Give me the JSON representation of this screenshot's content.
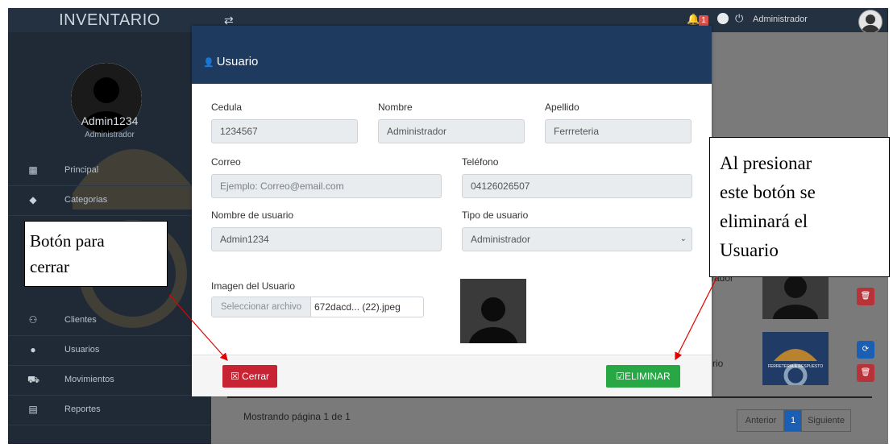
{
  "app": {
    "brand": "INVENTARIO"
  },
  "profile": {
    "name": "Admin1234",
    "role": "Administrador"
  },
  "menu": [
    {
      "label": "Principal",
      "icon": "dashboard-icon"
    },
    {
      "label": "Categorias",
      "icon": "tag-icon"
    },
    {
      "label": "Clientes",
      "icon": "users-icon"
    },
    {
      "label": "Usuarios",
      "icon": "user-icon"
    },
    {
      "label": "Movimientos",
      "icon": "cart-icon"
    },
    {
      "label": "Reportes",
      "icon": "report-icon"
    }
  ],
  "topbar": {
    "notifications": "1",
    "user": "Administrador"
  },
  "background": {
    "pagination_info": "Mostrando página 1 de 1",
    "prev": "Anterior",
    "page": "1",
    "next": "Siguiente",
    "row1_text": "rador",
    "row2_text": "rio",
    "logo_text": "FERRETERIA & RESPUESTO"
  },
  "modal": {
    "title": "Usuario",
    "fields": {
      "cedula": {
        "label": "Cedula",
        "value": "1234567"
      },
      "nombre": {
        "label": "Nombre",
        "value": "Administrador"
      },
      "apellido": {
        "label": "Apellido",
        "value": "Ferrreteria"
      },
      "correo": {
        "label": "Correo",
        "placeholder": "Ejemplo: Correo@email.com"
      },
      "telefono": {
        "label": "Teléfono",
        "value": "04126026507"
      },
      "username": {
        "label": "Nombre de usuario",
        "value": "Admin1234"
      },
      "tipo": {
        "label": "Tipo de usuario",
        "value": "Administrador"
      },
      "imagen": {
        "label": "Imagen del Usuario",
        "button": "Seleccionar archivo",
        "filename": "672dacd... (22).jpeg"
      }
    },
    "buttons": {
      "close": "Cerrar",
      "delete": "ELIMINAR"
    }
  },
  "annotations": {
    "left_line1": "Botón para",
    "left_line2": "cerrar",
    "right_line1": "Al presionar",
    "right_line2": "este botón se",
    "right_line3": "eliminará el",
    "right_line4": "Usuario"
  },
  "colors": {
    "sidebar": "#1f2a36",
    "header": "#1e3a5f",
    "danger": "#c82333",
    "success": "#28a745",
    "primary": "#1a73e8"
  }
}
